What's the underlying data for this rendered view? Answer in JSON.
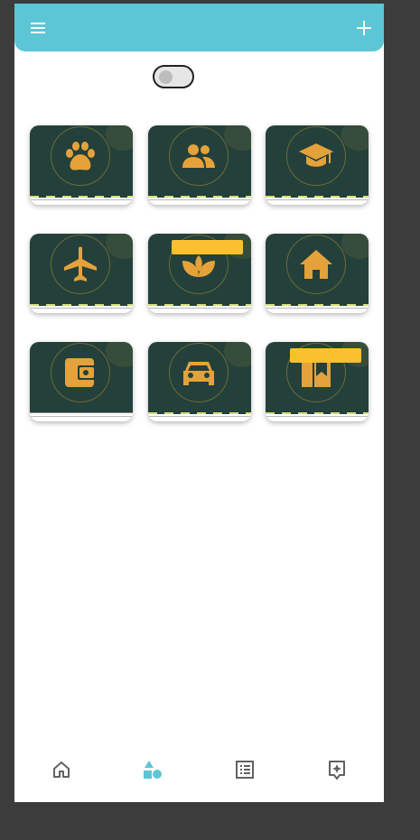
{
  "app_bar": {
    "color": "#5cc6d6",
    "menu_icon": "hamburger-menu-icon",
    "add_icon": "plus-icon"
  },
  "toggle": {
    "on": false
  },
  "tiles": [
    {
      "icon": "paw-icon"
    },
    {
      "icon": "people-icon"
    },
    {
      "icon": "graduation-cap-icon"
    },
    {
      "icon": "airplane-icon"
    },
    {
      "icon": "spa-icon",
      "badge": true
    },
    {
      "icon": "home-icon"
    },
    {
      "icon": "wallet-icon"
    },
    {
      "icon": "car-icon"
    },
    {
      "icon": "map-book-icon",
      "badge": true
    }
  ],
  "bottom_nav": {
    "items": [
      "home-icon",
      "shapes-icon",
      "list-icon",
      "sparkle-bookmark-icon"
    ],
    "active_index": 1,
    "active_color": "#5cc6d6",
    "inactive_color": "#616161"
  }
}
